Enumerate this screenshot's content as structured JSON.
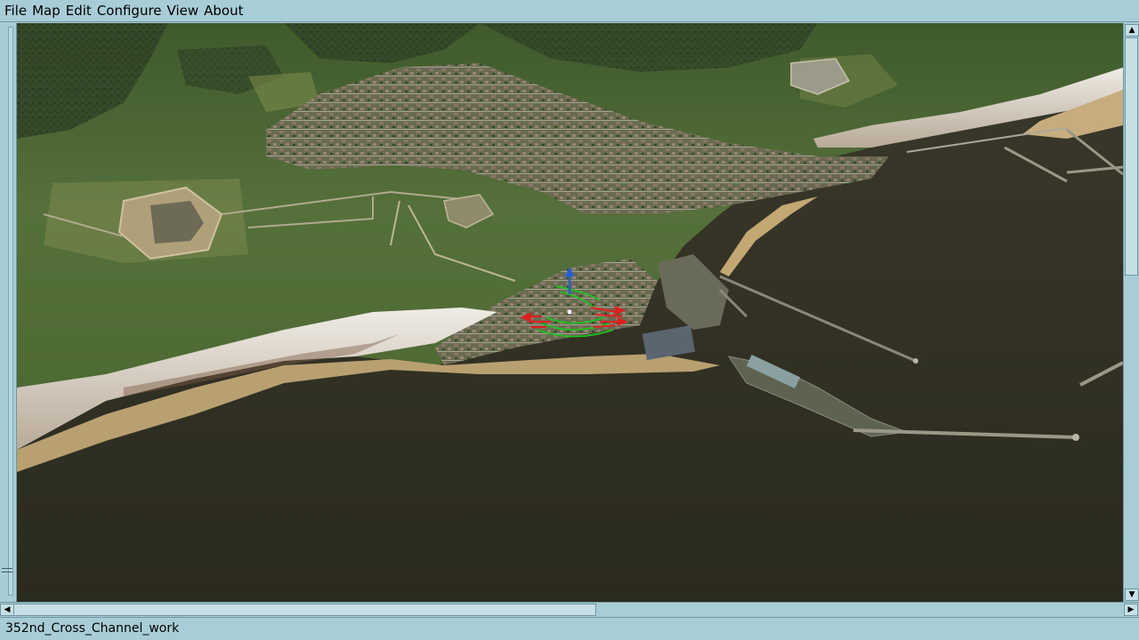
{
  "menu": {
    "file": "File",
    "map": "Map",
    "edit": "Edit",
    "configure": "Configure",
    "view": "View",
    "about": "About"
  },
  "status": {
    "mission_name": "352nd_Cross_Channel_work"
  },
  "scrollbars": {
    "up_arrow": "▲",
    "down_arrow": "▼",
    "left_arrow": "◀",
    "right_arrow": "▶"
  },
  "colors": {
    "chrome": "#a9cdd6",
    "sea": "#2f2f22",
    "land": "#4d6632",
    "cliffs": "#d8d4cc",
    "gizmo_x": "#e02020",
    "gizmo_y": "#2060e0",
    "gizmo_z": "#20c020"
  }
}
